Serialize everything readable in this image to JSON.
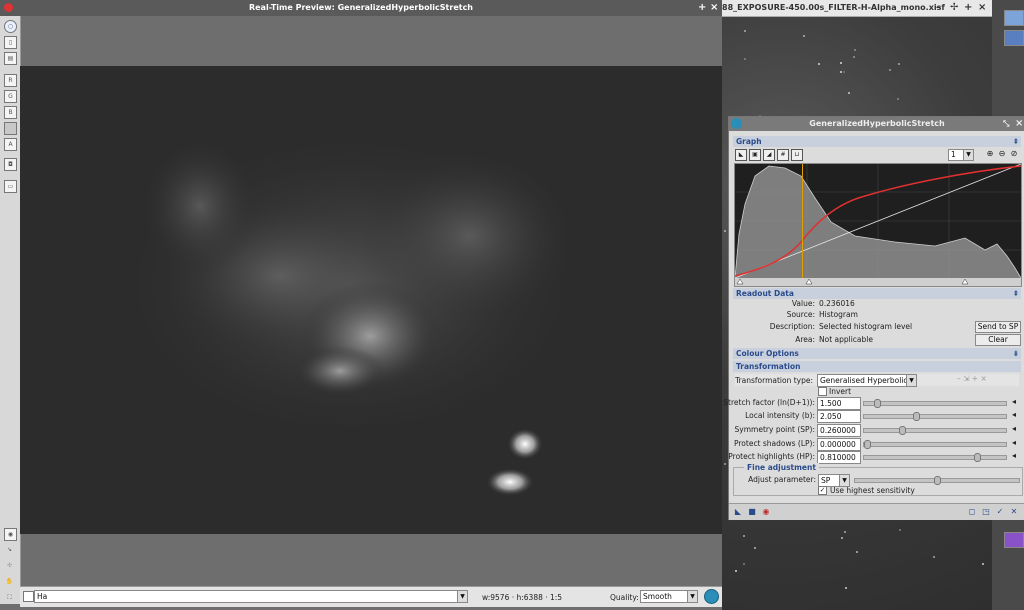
{
  "preview": {
    "title": "Real-Time Preview: GeneralizedHyperbolicStretch",
    "view_select": "Ha",
    "dims": "w:9576 · h:6388 · 1:5",
    "quality_label": "Quality:",
    "quality_value": "Smooth",
    "tools": [
      "R",
      "G",
      "B",
      "",
      "A"
    ]
  },
  "image_window": {
    "title": "88_EXPOSURE-450.00s_FILTER-H-Alpha_mono.xisf"
  },
  "dialog": {
    "title": "GeneralizedHyperbolicStretch",
    "graph_section": "Graph",
    "zoom_value": "1",
    "readout_section": "Readout Data",
    "value_label": "Value:",
    "value": "0.236016",
    "source_label": "Source:",
    "source": "Histogram",
    "description_label": "Description:",
    "description": "Selected histogram level",
    "area_label": "Area:",
    "area": "Not applicable",
    "send_to_sp": "Send to SP",
    "clear": "Clear",
    "colour_section": "Colour Options",
    "transformation_section": "Transformation",
    "transformation_type_label": "Transformation type:",
    "transformation_type": "Generalised Hyperbolic",
    "invert_label": "Invert",
    "params": [
      {
        "label": "Stretch factor (ln(D+1)):",
        "value": "1.500",
        "level": 0.07
      },
      {
        "label": "Local intensity (b):",
        "value": "2.050",
        "level": 0.36
      },
      {
        "label": "Symmetry point (SP):",
        "value": "0.260000",
        "level": 0.26
      },
      {
        "label": "Protect shadows (LP):",
        "value": "0.000000",
        "level": 0.0
      },
      {
        "label": "Protect highlights (HP):",
        "value": "0.810000",
        "level": 0.81
      }
    ],
    "fine_adjust_title": "Fine adjustment",
    "adjust_param_label": "Adjust parameter:",
    "adjust_param": "SP",
    "adjust_level": 0.5,
    "use_highest_label": "Use highest sensitivity",
    "symmetry_point": 0.236
  }
}
